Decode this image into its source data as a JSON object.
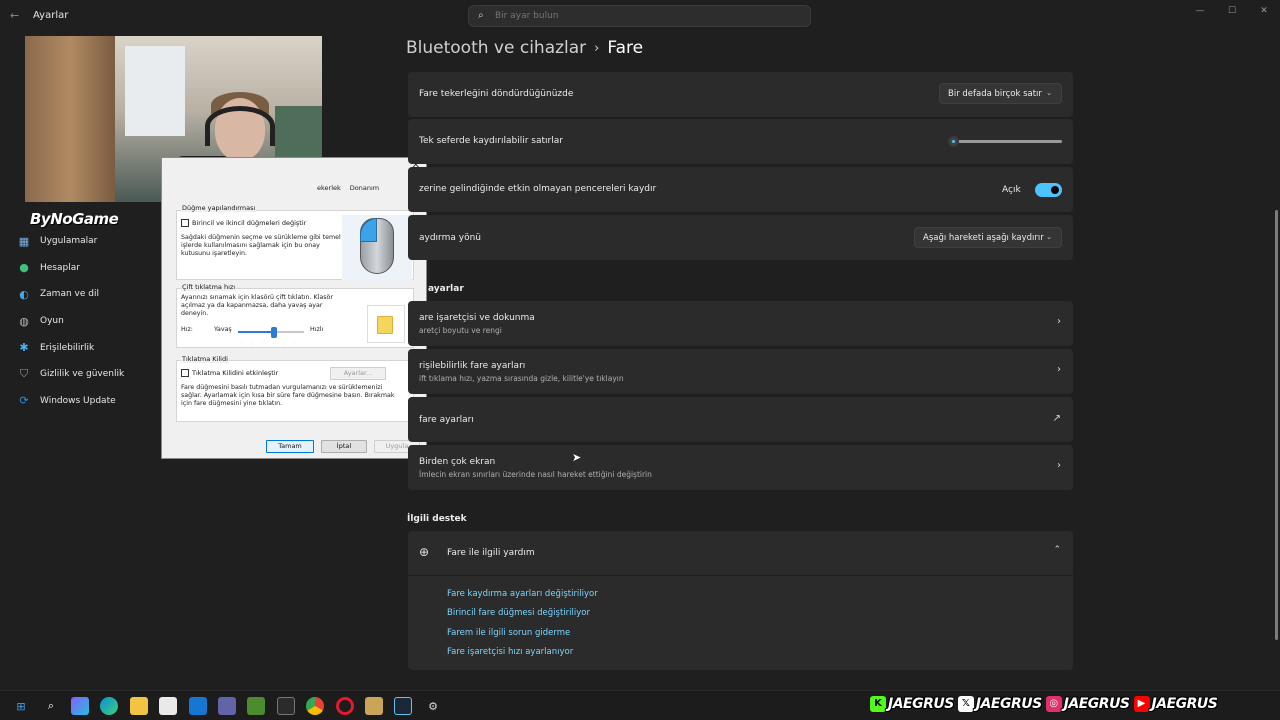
{
  "window": {
    "app_title": "Ayarlar",
    "search_placeholder": "Bir ayar bulun",
    "controls": [
      "—",
      "☐",
      "✕"
    ]
  },
  "webcam": {
    "overlay_logo": "ByNoGame"
  },
  "sidebar": {
    "items": [
      {
        "label": "Uygulamalar",
        "icon": "apps-icon",
        "icon_color": "#7fb0e6"
      },
      {
        "label": "Hesaplar",
        "icon": "accounts-icon",
        "icon_color": "#3ec07a"
      },
      {
        "label": "Zaman ve dil",
        "icon": "time-language-icon",
        "icon_color": "#4aa3e6"
      },
      {
        "label": "Oyun",
        "icon": "gaming-icon",
        "icon_color": "#b8b8b8"
      },
      {
        "label": "Erişilebilirlik",
        "icon": "accessibility-icon",
        "icon_color": "#4cb0f0"
      },
      {
        "label": "Gizlilik ve güvenlik",
        "icon": "privacy-shield-icon",
        "icon_color": "#9a9a9a"
      },
      {
        "label": "Windows Update",
        "icon": "windows-update-icon",
        "icon_color": "#2f8fe0"
      }
    ]
  },
  "dialog": {
    "tabs": [
      "ekerlek",
      "Donanım"
    ],
    "button_config": {
      "title": "Düğme yapılandırması",
      "checkbox_label": "Birincil ve ikincil düğmeleri değiştir",
      "description": "Sağdaki düğmenin seçme ve sürükleme gibi temel işlerde kullanılmasını sağlamak için bu onay kutusunu işaretleyin."
    },
    "double_click": {
      "title": "Çift tıklatma hızı",
      "description": "Ayarınızı sınamak için klasörü çift tıklatın. Klasör açılmaz ya da kapanmazsa, daha yavaş ayar deneyin.",
      "speed_label": "Hız:",
      "slow_label": "Yavaş",
      "fast_label": "Hızlı",
      "speed_value": 0.55
    },
    "click_lock": {
      "title": "Tıklatma Kilidi",
      "checkbox_label": "Tıklatma Kilidini etkinleştir",
      "settings_button": "Ayarlar...",
      "description": "Fare düğmesini basılı tutmadan vurgulamanızı ve sürüklemenizi sağlar. Ayarlamak için kısa bir süre fare düğmesine basın. Bırakmak için fare düğmesini yine tıklatın."
    },
    "buttons": {
      "ok": "Tamam",
      "cancel": "İptal",
      "apply": "Uygula"
    }
  },
  "breadcrumb": {
    "parent": "Bluetooth ve cihazlar",
    "separator": "›",
    "current": "Fare"
  },
  "settings": {
    "scroll_wheel": {
      "label": "Fare tekerleğini döndürdüğünüzde",
      "value": "Bir defada birçok satır"
    },
    "lines_to_scroll": {
      "label": "Tek seferde kaydırılabilir satırlar",
      "value": 0.02
    },
    "scroll_inactive": {
      "label": "zerine gelindiğinde etkin olmayan pencereleri kaydır",
      "state": "Açık",
      "enabled": true
    },
    "scroll_direction": {
      "label": "aydırma yönü",
      "value": "Aşağı hareketi aşağı kaydırır"
    }
  },
  "related_settings": {
    "title": "ayarlar",
    "items": [
      {
        "title": "are işaretçisi ve dokunma",
        "subtitle": "aretçi boyutu ve rengi",
        "trailing": "›"
      },
      {
        "title": "rişilebilirlik fare ayarları",
        "subtitle": "ift tıklama hızı, yazma sırasında gizle, kilitle'ye tıklayın",
        "trailing": "›"
      },
      {
        "title": "fare ayarları",
        "subtitle": "",
        "trailing": "↗"
      },
      {
        "title": "Birden çok ekran",
        "subtitle": "İmlecin ekran sınırları üzerinde nasıl hareket ettiğini değiştirin",
        "trailing": "›"
      }
    ]
  },
  "related_support": {
    "title": "İlgili destek",
    "header": "Fare ile ilgili yardım",
    "links": [
      "Fare kaydırma ayarları değiştiriliyor",
      "Birincil fare düğmesi değiştiriliyor",
      "Farem ile ilgili sorun giderme",
      "Fare işaretçisi hızı ayarlanıyor"
    ]
  },
  "taskbar": {
    "icons": [
      "windows-start-icon",
      "search-icon",
      "copilot-icon",
      "edge-icon",
      "file-explorer-icon",
      "store-icon",
      "outlook-icon",
      "teams-icon",
      "minecraft-icon",
      "epic-icon",
      "chrome-icon",
      "opera-icon",
      "league-icon",
      "steam-icon",
      "settings-icon"
    ]
  },
  "social": [
    {
      "icon": "kick-icon",
      "glyph": "K",
      "color": "#53fc18",
      "handle": "JAEGRUS"
    },
    {
      "icon": "x-icon",
      "glyph": "𝕏",
      "color": "#ffffff",
      "handle": "JAEGRUS"
    },
    {
      "icon": "instagram-icon",
      "glyph": "◎",
      "color": "#e1306c",
      "handle": "JAEGRUS"
    },
    {
      "icon": "youtube-icon",
      "glyph": "▶",
      "color": "#ff0000",
      "handle": "JAEGRUS"
    }
  ],
  "colors": {
    "accent": "#4cc2ff",
    "link": "#7fd6ff",
    "card": "#2b2b2b",
    "background": "#1f1f1f"
  }
}
